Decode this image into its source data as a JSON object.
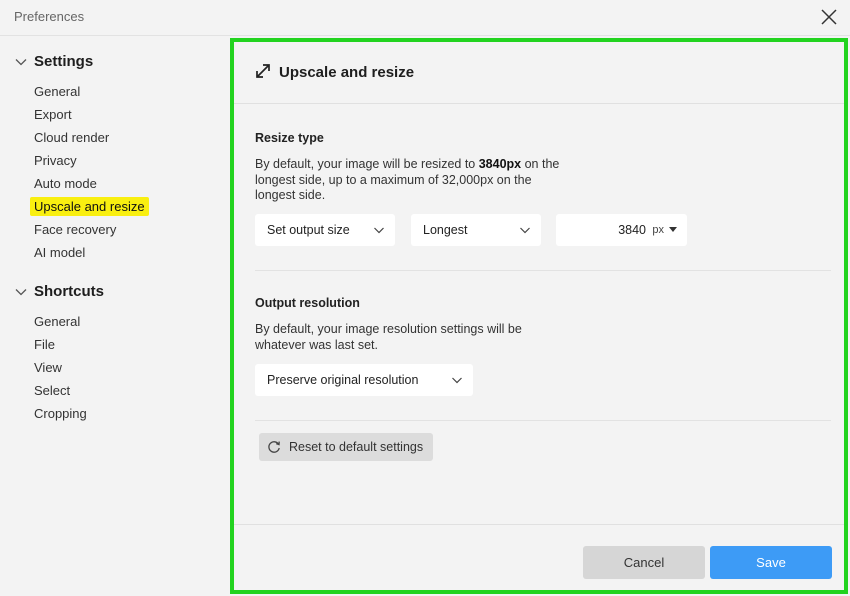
{
  "window": {
    "title": "Preferences"
  },
  "sidebar": {
    "settings_label": "Settings",
    "settings_items": [
      {
        "label": "General"
      },
      {
        "label": "Export"
      },
      {
        "label": "Cloud render"
      },
      {
        "label": "Privacy"
      },
      {
        "label": "Auto mode"
      },
      {
        "label": "Upscale and resize",
        "active": true
      },
      {
        "label": "Face recovery"
      },
      {
        "label": "AI model"
      }
    ],
    "shortcuts_label": "Shortcuts",
    "shortcuts_items": [
      {
        "label": "General"
      },
      {
        "label": "File"
      },
      {
        "label": "View"
      },
      {
        "label": "Select"
      },
      {
        "label": "Cropping"
      }
    ]
  },
  "panel": {
    "title": "Upscale and resize",
    "resize_type": {
      "title": "Resize type",
      "desc_prefix": "By default, your image will be resized to ",
      "desc_bold": "3840px",
      "desc_suffix": " on the longest side, up to a maximum of 32,000px on the longest side.",
      "mode_value": "Set output size",
      "side_value": "Longest",
      "size_value": "3840",
      "unit_value": "px"
    },
    "output_resolution": {
      "title": "Output resolution",
      "desc": "By default, your image resolution settings will be whatever was last set.",
      "value": "Preserve original resolution"
    },
    "reset_label": "Reset to default settings",
    "cancel_label": "Cancel",
    "save_label": "Save"
  },
  "colors": {
    "highlight": "#f9ef10",
    "panel_border": "#22d31f",
    "save_button": "#3d9bf6",
    "cancel_button": "#d6d6d6"
  }
}
